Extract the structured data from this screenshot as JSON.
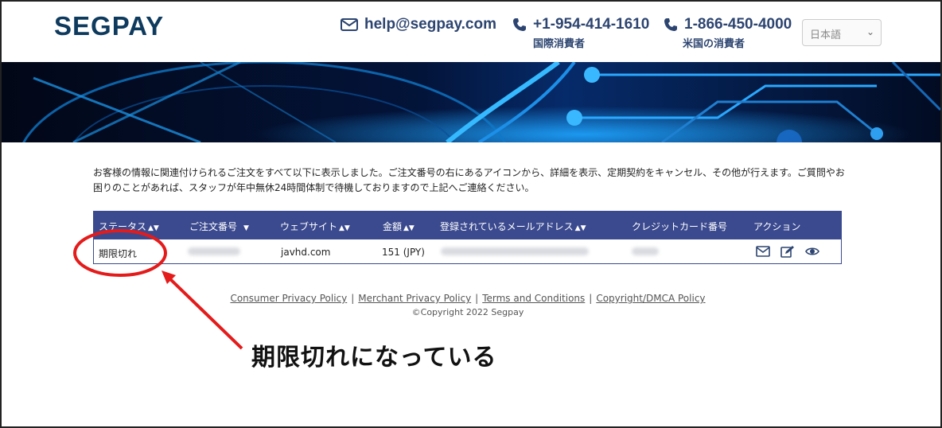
{
  "header": {
    "logo_seg": "SEG",
    "logo_g": "",
    "logo_pay": "PAY",
    "email": "help@segpay.com",
    "intl_phone": "+1-954-414-1610",
    "intl_label": "国際消費者",
    "us_phone": "1-866-450-4000",
    "us_label": "米国の消費者",
    "language": "日本語"
  },
  "description": "お客様の情報に関連付けられるご注文をすべて以下に表示しました。ご注文番号の右にあるアイコンから、詳細を表示、定期契約をキャンセル、その他が行えます。ご質問やお困りのことがあれば、スタッフが年中無休24時間体制で待機しておりますので上記へご連絡ください。",
  "table": {
    "headers": {
      "status": "ステータス",
      "order_number": "ご注文番号",
      "website": "ウェブサイト",
      "amount": "金額",
      "email": "登録されているメールアドレス",
      "card": "クレジットカード番号",
      "actions": "アクション"
    },
    "rows": [
      {
        "status": "期限切れ",
        "website": "javhd.com",
        "amount": "151 (JPY)"
      }
    ]
  },
  "footer": {
    "links": [
      "Consumer Privacy Policy",
      "Merchant Privacy Policy",
      "Terms and Conditions",
      "Copyright/DMCA Policy"
    ],
    "copyright": "©Copyright 2022 Segpay"
  },
  "annotation": {
    "text": "期限切れになっている",
    "color": "#e41b1b"
  }
}
